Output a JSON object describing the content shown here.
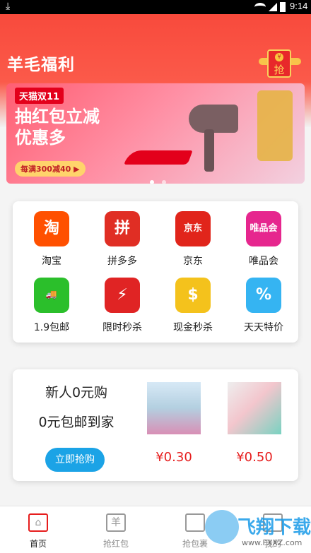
{
  "status": {
    "time": "9:14"
  },
  "app": {
    "title": "羊毛福利"
  },
  "header": {
    "grab_button": "抢",
    "grab_coin": "¥"
  },
  "banner": {
    "tag": "天猫双11",
    "headline_line1": "抽红包立减",
    "headline_line2": "优惠多",
    "pill": "每满300减40 ▶"
  },
  "grid": [
    {
      "label": "淘宝",
      "icon": "taobao-icon",
      "glyph": "淘",
      "color": "#ff5000"
    },
    {
      "label": "拼多多",
      "icon": "pinduoduo-icon",
      "glyph": "拼",
      "color": "#e02e24"
    },
    {
      "label": "京东",
      "icon": "jd-icon",
      "glyph": "京东",
      "color": "#e1251b"
    },
    {
      "label": "唯品会",
      "icon": "vip-icon",
      "glyph": "唯品会",
      "color": "#e6268e"
    },
    {
      "label": "1.9包邮",
      "icon": "truck-icon",
      "glyph": "🚚",
      "color": "#2bbf2b"
    },
    {
      "label": "限时秒杀",
      "icon": "lightning-icon",
      "glyph": "⚡",
      "color": "#e02424"
    },
    {
      "label": "现金秒杀",
      "icon": "coins-icon",
      "glyph": "$",
      "color": "#f4c21c"
    },
    {
      "label": "天天特价",
      "icon": "price-tag-icon",
      "glyph": "%",
      "color": "#35b4f2"
    }
  ],
  "promo": {
    "line1": "新人0元购",
    "line2": "0元包邮到家",
    "button": "立即抢购",
    "products": [
      {
        "price": "¥0.30"
      },
      {
        "price": "¥0.50"
      }
    ]
  },
  "tabs": [
    {
      "label": "首页",
      "icon": "home-icon",
      "glyph": "⌂"
    },
    {
      "label": "抢红包",
      "icon": "red-envelope-icon",
      "glyph": "羊"
    },
    {
      "label": "抢包裹",
      "icon": "package-icon",
      "glyph": ""
    },
    {
      "label": "我的",
      "icon": "user-icon",
      "glyph": ""
    }
  ],
  "watermark": {
    "text": "飞翔下载",
    "sub": "www.FXXZ.com"
  }
}
